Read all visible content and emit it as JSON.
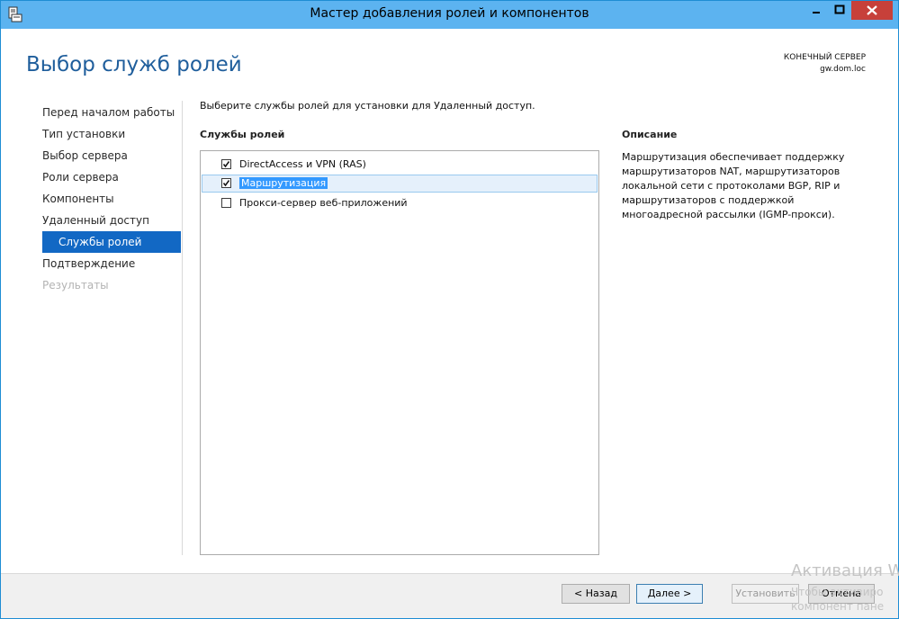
{
  "window": {
    "title": "Мастер добавления ролей и компонентов"
  },
  "header": {
    "page_title": "Выбор служб ролей",
    "destination_label": "КОНЕЧНЫЙ СЕРВЕР",
    "destination_server": "gw.dom.loc"
  },
  "nav": {
    "items": [
      {
        "label": "Перед началом работы",
        "state": "normal"
      },
      {
        "label": "Тип установки",
        "state": "normal"
      },
      {
        "label": "Выбор сервера",
        "state": "normal"
      },
      {
        "label": "Роли сервера",
        "state": "normal"
      },
      {
        "label": "Компоненты",
        "state": "normal"
      },
      {
        "label": "Удаленный доступ",
        "state": "normal"
      },
      {
        "label": "Службы ролей",
        "state": "active"
      },
      {
        "label": "Подтверждение",
        "state": "normal"
      },
      {
        "label": "Результаты",
        "state": "disabled"
      }
    ]
  },
  "main": {
    "intro": "Выберите службы ролей для установки для Удаленный доступ.",
    "services_header": "Службы ролей",
    "services": [
      {
        "label": "DirectAccess и VPN (RAS)",
        "checked": true,
        "selected": false
      },
      {
        "label": "Маршрутизация",
        "checked": true,
        "selected": true
      },
      {
        "label": "Прокси-сервер веб-приложений",
        "checked": false,
        "selected": false
      }
    ],
    "description_header": "Описание",
    "description": "Маршрутизация обеспечивает поддержку маршрутизаторов NAT, маршрутизаторов локальной сети с протоколами BGP, RIP и маршрутизаторов с поддержкой многоадресной рассылки (IGMP-прокси)."
  },
  "footer": {
    "back_label": "< Назад",
    "next_label": "Далее >",
    "install_label": "Установить",
    "cancel_label": "Отмена"
  },
  "watermark": {
    "line1": "Активация W",
    "line2": "Чтобы активиро",
    "line3": "компонент пане"
  },
  "colors": {
    "titlebar": "#5cb3f0",
    "accent": "#1268c4",
    "close_button": "#c7403a",
    "page_title": "#1f5e9c"
  }
}
